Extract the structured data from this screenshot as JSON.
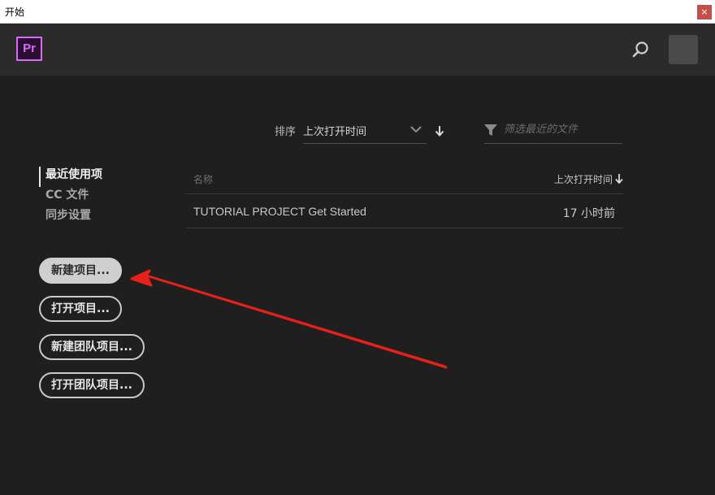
{
  "window": {
    "title": "开始",
    "close_label": "×"
  },
  "header": {
    "logo_text": "Pr",
    "logo_color": "#d86cf6",
    "search_icon": "search-icon",
    "avatar_icon": "avatar"
  },
  "sort": {
    "label": "排序",
    "value": "上次打开时间",
    "direction_icon": "arrow-down-icon"
  },
  "filter": {
    "placeholder": "筛选最近的文件",
    "value": ""
  },
  "sidebar": {
    "items": [
      {
        "label": "最近使用项",
        "active": true
      },
      {
        "label": "CC 文件",
        "active": false
      },
      {
        "label": "同步设置",
        "active": false
      }
    ]
  },
  "buttons": {
    "new_project": "新建项目...",
    "open_project": "打开项目...",
    "new_team_project": "新建团队项目...",
    "open_team_project": "打开团队项目..."
  },
  "table": {
    "headers": {
      "name": "名称",
      "time": "上次打开时间"
    },
    "rows": [
      {
        "name": "TUTORIAL PROJECT Get Started",
        "time": "17 小时前"
      }
    ]
  },
  "annotation": {
    "arrow_color": "#e8201a"
  }
}
